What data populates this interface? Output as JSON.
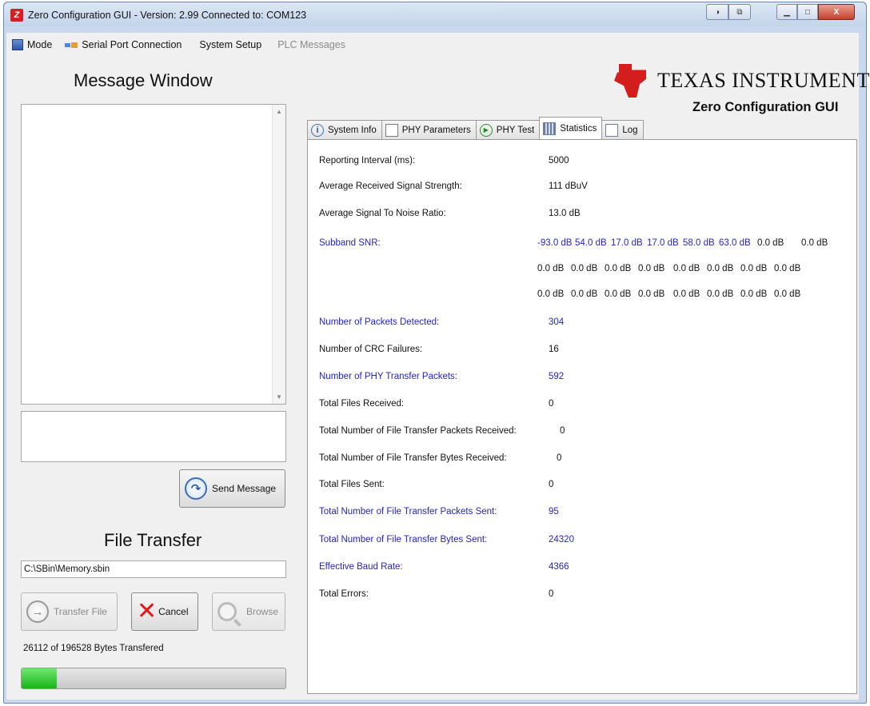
{
  "window": {
    "title": "Zero Configuration GUI - Version: 2.99    Connected to: COM123",
    "icon": "app-logo-icon",
    "controls": [
      "help",
      "restore-alt",
      "minimize",
      "maximize",
      "close"
    ],
    "close_label": "X"
  },
  "menu": {
    "items": [
      {
        "label": "Mode",
        "icon": "mode-icon",
        "disabled": false
      },
      {
        "label": "Serial Port Connection",
        "icon": "plug-icon",
        "disabled": false
      },
      {
        "label": "System Setup",
        "icon": "",
        "disabled": false
      },
      {
        "label": "PLC Messages",
        "icon": "",
        "disabled": true
      }
    ]
  },
  "left": {
    "message_window_title": "Message Window",
    "message_text": "",
    "message_input": "",
    "send_button": "Send Message",
    "file_transfer_title": "File Transfer",
    "file_path": "C:\\SBin\\Memory.sbin",
    "transfer_button": "Transfer File",
    "cancel_button": "Cancel",
    "browse_button": "Browse",
    "bytes_status": "26112 of 196528 Bytes Transfered",
    "progress": 0.133
  },
  "logo": {
    "company": "Texas Instruments",
    "product": "Zero Configuration GUI"
  },
  "tabs": [
    {
      "label": "System Info",
      "icon": "info-icon",
      "active": false
    },
    {
      "label": "PHY Parameters",
      "icon": "document-icon",
      "active": false
    },
    {
      "label": "PHY Test",
      "icon": "play-icon",
      "active": false
    },
    {
      "label": "Statistics",
      "icon": "statistics-icon",
      "active": true
    },
    {
      "label": "Log",
      "icon": "log-icon",
      "active": false
    }
  ],
  "statistics": {
    "reporting_interval": {
      "label": "Reporting Interval (ms):",
      "value": "5000"
    },
    "avg_signal_strength": {
      "label": "Average Received Signal Strength:",
      "value": "111 dBuV"
    },
    "avg_snr": {
      "label": "Average Signal To Noise Ratio:",
      "value": "13.0 dB"
    },
    "subband_snr": {
      "label": "Subband SNR:",
      "rows": [
        [
          "-93.0 dB",
          "54.0 dB",
          "17.0 dB",
          "17.0 dB",
          "58.0 dB",
          "63.0 dB",
          "0.0 dB",
          "0.0 dB"
        ],
        [
          "0.0 dB",
          "0.0 dB",
          "0.0 dB",
          "0.0 dB",
          "0.0 dB",
          "0.0 dB",
          "0.0 dB",
          "0.0 dB"
        ],
        [
          "0.0 dB",
          "0.0 dB",
          "0.0 dB",
          "0.0 dB",
          "0.0 dB",
          "0.0 dB",
          "0.0 dB",
          "0.0 dB"
        ]
      ]
    },
    "packets_detected": {
      "label": "Number of Packets Detected:",
      "value": "304"
    },
    "crc_failures": {
      "label": "Number of CRC Failures:",
      "value": "16"
    },
    "phy_transfer_packets": {
      "label": "Number of PHY Transfer Packets:",
      "value": "592"
    },
    "files_received": {
      "label": "Total Files Received:",
      "value": "0"
    },
    "ft_packets_received": {
      "label": "Total Number of File Transfer Packets Received:",
      "value": "0"
    },
    "ft_bytes_received": {
      "label": "Total Number of File Transfer Bytes Received:",
      "value": "0"
    },
    "files_sent": {
      "label": "Total Files Sent:",
      "value": "0"
    },
    "ft_packets_sent": {
      "label": "Total Number of File Transfer Packets Sent:",
      "value": "95"
    },
    "ft_bytes_sent": {
      "label": "Total Number of File Transfer Bytes Sent:",
      "value": "24320"
    },
    "effective_baud": {
      "label": "Effective Baud Rate:",
      "value": "4366"
    },
    "total_errors": {
      "label": "Total Errors:",
      "value": "0"
    }
  },
  "colors": {
    "highlight_text": "#2424c8",
    "progress_fill": "#17b417",
    "brand_red": "#d41d1d"
  }
}
